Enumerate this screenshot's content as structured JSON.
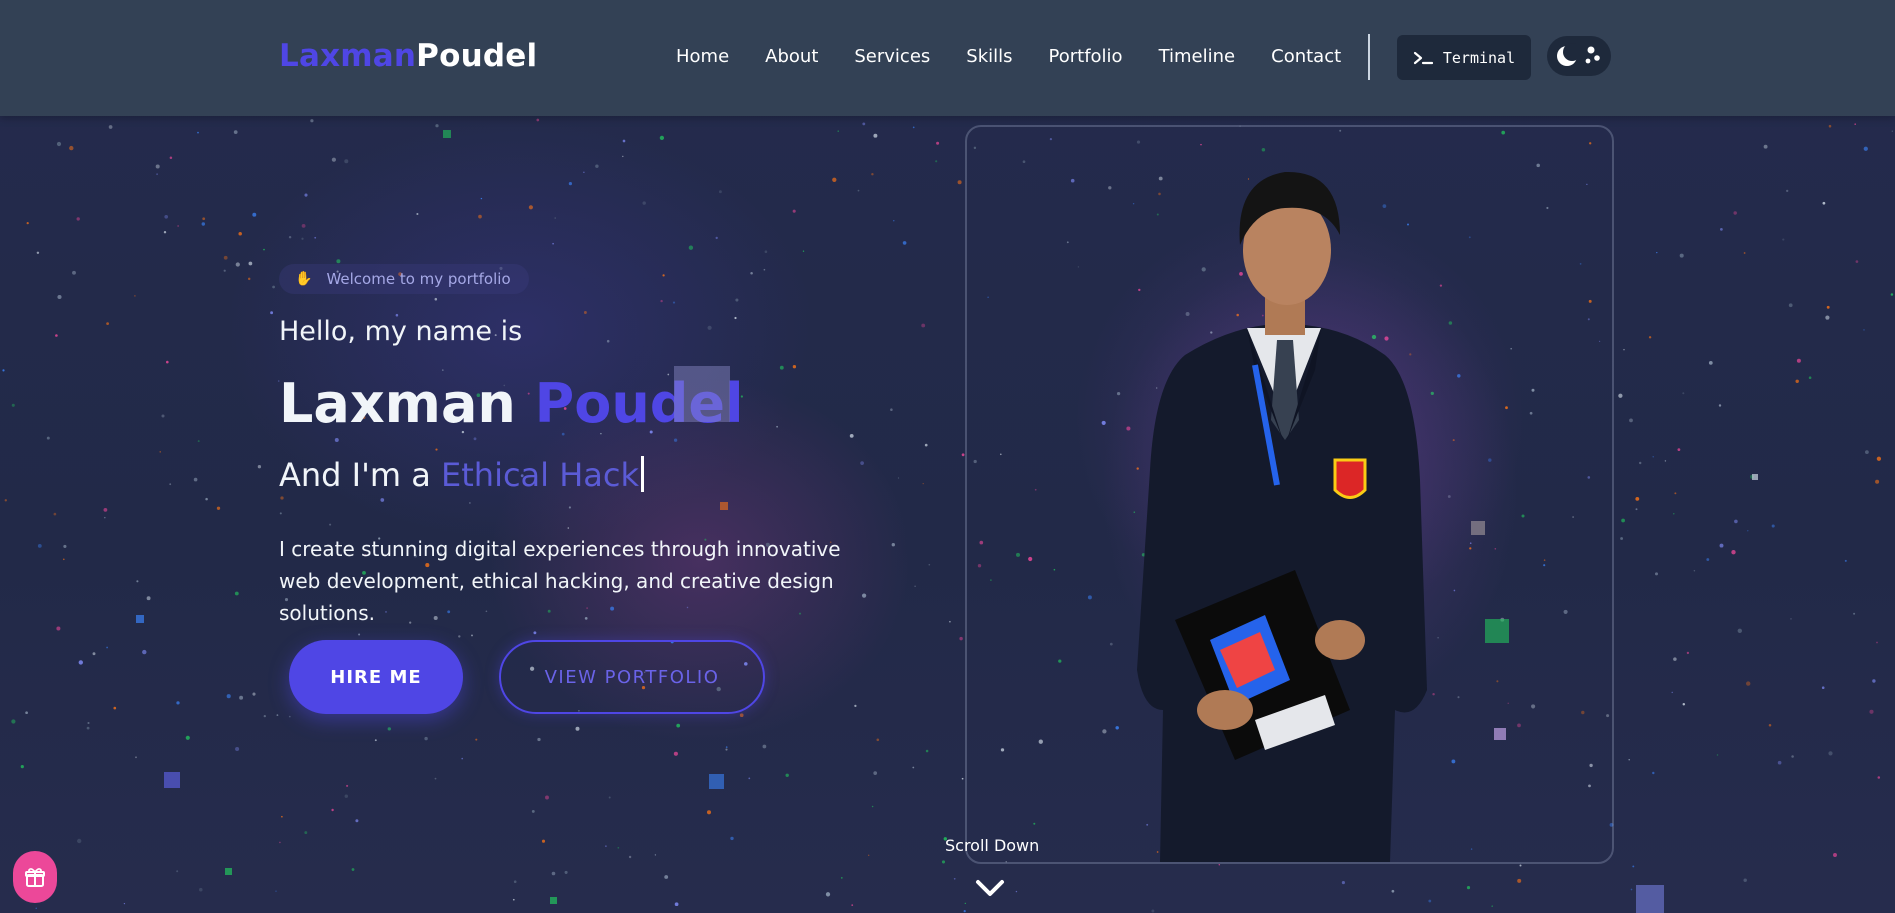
{
  "logo": {
    "first": "Laxman",
    "last": "Poudel"
  },
  "nav": {
    "items": [
      {
        "label": "Home"
      },
      {
        "label": "About"
      },
      {
        "label": "Services"
      },
      {
        "label": "Skills"
      },
      {
        "label": "Portfolio"
      },
      {
        "label": "Timeline"
      },
      {
        "label": "Contact"
      }
    ],
    "terminal_label": "Terminal",
    "theme_toggle_icon": "moon-icon"
  },
  "hero": {
    "welcome": "Welcome to my portfolio",
    "welcome_icon": "waving-hand-icon",
    "hello": "Hello, my name is",
    "name_first": "Laxman",
    "name_last": "Poudel",
    "role_prefix": "And I'm a",
    "role_typed": "Ethical Hack",
    "description": "I create stunning digital experiences through innovative web development, ethical hacking, and creative design solutions.",
    "hire_label": "HIRE ME",
    "portfolio_label": "VIEW PORTFOLIO"
  },
  "scroll": {
    "label": "Scroll Down"
  },
  "colors": {
    "accent": "#4f46e5",
    "navbar": "#334155",
    "background": "#232a4a",
    "gift": "#ec4899"
  }
}
